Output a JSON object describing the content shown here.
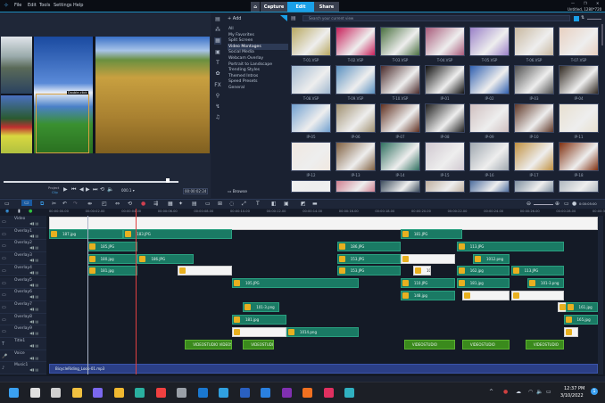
{
  "window": {
    "title": "Untitled, 1280*720",
    "menu": [
      "File",
      "Edit",
      "Tools",
      "Settings",
      "Help"
    ],
    "modes": [
      "Capture",
      "Edit",
      "Share"
    ],
    "active_mode": "Edit",
    "controls": [
      "—",
      "❐",
      "✕"
    ]
  },
  "preview": {
    "overlay_caption": "Double-click",
    "toggle": [
      "Project",
      "Clip"
    ],
    "timecode": "00:00:02:24",
    "progress": 0.97,
    "quality": "000.1 ▾"
  },
  "library": {
    "add_label": "Add",
    "search_placeholder": "Search your current view",
    "browse_label": "Browse",
    "categories": [
      "All",
      "My Favorites",
      "Split Screen",
      "Video Montages",
      "Social Media",
      "Webcam Overlay",
      "Portrait to Landscape",
      "Trending Styles",
      "Themed Intros",
      "Speed Presets",
      "General"
    ],
    "selected_category": "Video Montages",
    "thumbnails": [
      "T-01.VSP",
      "T-02.VSP",
      "T-03.VSP",
      "T-04.VSP",
      "T-05.VSP",
      "T-06.VSP",
      "T-07.VSP",
      "T-08.VSP",
      "T-09.VSP",
      "T-10.VSP",
      "IP-01",
      "IP-02",
      "IP-03",
      "IP-04",
      "IP-05",
      "IP-06",
      "IP-07",
      "IP-08",
      "IP-09",
      "IP-10",
      "IP-11",
      "IP-12",
      "IP-13",
      "IP-14",
      "IP-15",
      "IP-16",
      "IP-17",
      "IP-18",
      "",
      "",
      "",
      "",
      "",
      "",
      ""
    ],
    "thumb_colors": [
      "#b8a860",
      "#c8205a",
      "#4a7040",
      "#a85a7a",
      "#9a80c8",
      "#c8b8a0",
      "#e8d0c0",
      "#a0b8d0",
      "#5a90c0",
      "#4a2a2a",
      "#101010",
      "#3060b0",
      "#505050",
      "#302820",
      "#70a0d0",
      "#a09070",
      "#603020",
      "#202020",
      "#d0c0c0",
      "#603828",
      "#e8e0d0",
      "#f0e8e0",
      "#806040",
      "#307060",
      "#d0c8d0",
      "#a0a8b0",
      "#c09040",
      "#803010",
      "#f0f0f0",
      "#d08090",
      "#405060",
      "#c0b0a0",
      "#5070a0",
      "#8090a0",
      "#b0b8c0"
    ]
  },
  "timeline": {
    "ruler": [
      "00:00:00.00",
      "00:00:02.00",
      "00:00:04.00",
      "00:00:06.00",
      "00:00:08.00",
      "00:00:10.00",
      "00:00:12.00",
      "00:00:14.00",
      "00:00:16.00",
      "00:00:18.00",
      "00:00:20.00",
      "00:00:22.00",
      "00:00:24.00",
      "00:00:26.00",
      "00:00:28.00",
      "00:00:30.00"
    ],
    "playhead_seconds": 4.8,
    "marker_seconds": 2.1,
    "fit_label": "0:00:05:00",
    "tracks": [
      "Video",
      "Overlay1",
      "Overlay2",
      "Overlay3",
      "Overlay4",
      "Overlay5",
      "Overlay6",
      "Overlay7",
      "Overlay8",
      "Overlay9",
      "Title1",
      "Voice",
      "Music1"
    ],
    "clips": [
      {
        "track": 0,
        "start": 0,
        "end": 30.3,
        "label": "",
        "kind": "white"
      },
      {
        "track": 1,
        "start": 0,
        "end": 4.1,
        "label": "187.jpg",
        "kind": "image"
      },
      {
        "track": 1,
        "start": 4.1,
        "end": 10.1,
        "label": "183.JPG",
        "kind": "image"
      },
      {
        "track": 1,
        "start": 19.4,
        "end": 22.8,
        "label": "181.JPG",
        "kind": "image"
      },
      {
        "track": 2,
        "start": 2.1,
        "end": 4.9,
        "label": "185.JPG",
        "kind": "image"
      },
      {
        "track": 2,
        "start": 15.9,
        "end": 19.4,
        "label": "186.JPG",
        "kind": "image"
      },
      {
        "track": 2,
        "start": 22.5,
        "end": 28.4,
        "label": "113.JPG",
        "kind": "image"
      },
      {
        "track": 3,
        "start": 2.1,
        "end": 4.9,
        "label": "180.jpg",
        "kind": "image"
      },
      {
        "track": 3,
        "start": 4.9,
        "end": 8.0,
        "label": "186.JPG",
        "kind": "image"
      },
      {
        "track": 3,
        "start": 15.9,
        "end": 19.4,
        "label": "153.JPG",
        "kind": "image"
      },
      {
        "track": 3,
        "start": 19.4,
        "end": 22.4,
        "label": "",
        "kind": "white"
      },
      {
        "track": 3,
        "start": 23.4,
        "end": 25.4,
        "label": "1012.png",
        "kind": "image"
      },
      {
        "track": 4,
        "start": 2.1,
        "end": 4.9,
        "label": "181.jpg",
        "kind": "image"
      },
      {
        "track": 4,
        "start": 7.1,
        "end": 10.1,
        "label": "",
        "kind": "white"
      },
      {
        "track": 4,
        "start": 15.9,
        "end": 19.4,
        "label": "153.JPG",
        "kind": "image"
      },
      {
        "track": 4,
        "start": 20.1,
        "end": 21.1,
        "label": "101-1.jpg",
        "kind": "white"
      },
      {
        "track": 4,
        "start": 22.5,
        "end": 25.4,
        "label": "162.jpg",
        "kind": "image"
      },
      {
        "track": 4,
        "start": 25.5,
        "end": 28.4,
        "label": "113.JPG",
        "kind": "image"
      },
      {
        "track": 5,
        "start": 10.1,
        "end": 17.1,
        "label": "105.JPG",
        "kind": "image"
      },
      {
        "track": 5,
        "start": 19.4,
        "end": 22.4,
        "label": "110.JPG",
        "kind": "image"
      },
      {
        "track": 5,
        "start": 22.5,
        "end": 25.4,
        "label": "181.jpg",
        "kind": "image"
      },
      {
        "track": 5,
        "start": 26.4,
        "end": 28.4,
        "label": "101-3.png",
        "kind": "image"
      },
      {
        "track": 6,
        "start": 19.4,
        "end": 22.4,
        "label": "148.jpg",
        "kind": "image"
      },
      {
        "track": 6,
        "start": 22.8,
        "end": 25.4,
        "label": "",
        "kind": "white"
      },
      {
        "track": 6,
        "start": 25.5,
        "end": 28.4,
        "label": "",
        "kind": "white"
      },
      {
        "track": 7,
        "start": 10.7,
        "end": 12.7,
        "label": "101-3.png",
        "kind": "image"
      },
      {
        "track": 7,
        "start": 28.1,
        "end": 28.4,
        "label": "",
        "kind": "white"
      },
      {
        "track": 7,
        "start": 28.5,
        "end": 30.3,
        "label": "161.jpg",
        "kind": "image"
      },
      {
        "track": 8,
        "start": 10.1,
        "end": 13.1,
        "label": "181.jpg",
        "kind": "image"
      },
      {
        "track": 8,
        "start": 28.4,
        "end": 30.3,
        "label": "165.jpg",
        "kind": "image"
      },
      {
        "track": 9,
        "start": 10.1,
        "end": 13.1,
        "label": "",
        "kind": "white"
      },
      {
        "track": 9,
        "start": 13.1,
        "end": 17.1,
        "label": "1014.png",
        "kind": "image"
      },
      {
        "track": 9,
        "start": 28.4,
        "end": 28.8,
        "label": "",
        "kind": "white"
      },
      {
        "track": 10,
        "start": 7.5,
        "end": 10.1,
        "label": "VIDEOSTUDIO VIDEOSTU",
        "kind": "title"
      },
      {
        "track": 10,
        "start": 10.7,
        "end": 12.4,
        "label": "VIDEOSTUDIO",
        "kind": "title"
      },
      {
        "track": 10,
        "start": 19.6,
        "end": 22.4,
        "label": "VIDEOSTUDIO",
        "kind": "title"
      },
      {
        "track": 10,
        "start": 22.8,
        "end": 25.4,
        "label": "VIDEOSTUDIO",
        "kind": "title"
      },
      {
        "track": 10,
        "start": 26.3,
        "end": 28.4,
        "label": "VIDEOSTUDIO",
        "kind": "title"
      },
      {
        "track": 12,
        "start": 0,
        "end": 30.3,
        "label": "BicycleRiding_Loop-01.mp3",
        "kind": "music"
      }
    ]
  },
  "taskbar": {
    "time": "12:37 PM",
    "date": "3/10/2022",
    "notification_count": "1",
    "apps": [
      {
        "name": "start",
        "color": "#3aa0f0"
      },
      {
        "name": "search",
        "color": "#e0e0e0"
      },
      {
        "name": "task-view",
        "color": "#d0d0d0"
      },
      {
        "name": "widgets",
        "color": "#f0c040"
      },
      {
        "name": "teams",
        "color": "#7b68ee"
      },
      {
        "name": "file-explorer",
        "color": "#f0b830"
      },
      {
        "name": "edge",
        "color": "#2ab0a0"
      },
      {
        "name": "store",
        "color": "#f04040"
      },
      {
        "name": "settings",
        "color": "#9aa0a8"
      },
      {
        "name": "outlook",
        "color": "#1a78d0"
      },
      {
        "name": "cortana",
        "color": "#30a0e0"
      },
      {
        "name": "word",
        "color": "#2a60c0"
      },
      {
        "name": "phone",
        "color": "#2a80e0"
      },
      {
        "name": "onenote",
        "color": "#8030b0"
      },
      {
        "name": "firefox",
        "color": "#f07020"
      },
      {
        "name": "slack",
        "color": "#e03060"
      },
      {
        "name": "videostudio",
        "color": "#30b0c0"
      }
    ]
  }
}
